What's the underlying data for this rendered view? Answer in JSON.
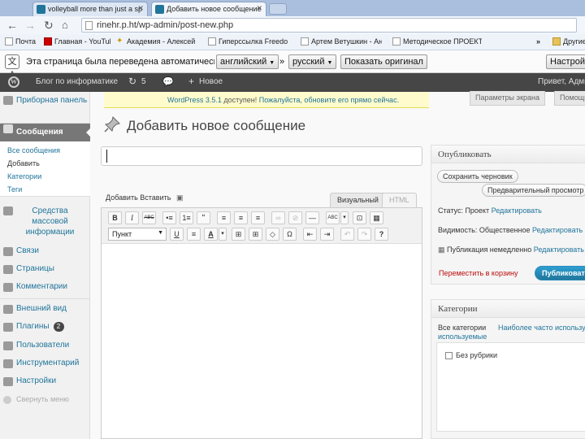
{
  "browser": {
    "tabs": [
      {
        "title": "volleyball more than just a sp"
      },
      {
        "title": "Добавить новое сообщение"
      }
    ],
    "url": "rinehr.p.ht/wp-admin/post-new.php",
    "bookmarks": [
      {
        "label": "Почта"
      },
      {
        "label": "Главная - YouTube"
      },
      {
        "label": "Академия - Алексей Ка"
      },
      {
        "label": "Гиперссылка Freedo"
      },
      {
        "label": "Артем Ветушкин - Ан"
      },
      {
        "label": "Методическое ПРОЕКТ"
      },
      {
        "label": "Другие"
      }
    ],
    "overflow": "»"
  },
  "translate_bar": {
    "message": "Эта страница была переведена автоматически",
    "from_language": "английский",
    "arrow": "»",
    "to_language": "русский",
    "show_original": "Показать оригинал",
    "settings": "Настройки"
  },
  "admin_bar": {
    "site_name": "Блог по информатике",
    "updates_count": "5",
    "new_label": "Новое",
    "greeting": "Привет, Адми"
  },
  "sidebar": {
    "dashboard": "Приборная панель",
    "posts": "Сообщения",
    "submenu": [
      "Все сообщения",
      "Добавить",
      "Категории",
      "Теги"
    ],
    "media": "Средства массовой информации",
    "links": "Связи",
    "pages": "Страницы",
    "comments": "Комментарии",
    "appearance": "Внешний вид",
    "plugins": "Плагины",
    "plugins_badge": "2",
    "users": "Пользователи",
    "tools": "Инструментарий",
    "settings": "Настройки",
    "collapse": "Свернуть меню"
  },
  "notice": {
    "version": "WordPress 3.5.1",
    "text": " доступен! ",
    "link": "Пожалуйста, обновите его прямо сейчас."
  },
  "screen_options": "Параметры экрана",
  "help": "Помощь",
  "page_title": "Добавить новое сообщение",
  "editor": {
    "add_media": "Добавить Вставить",
    "tab_visual": "Визуальный",
    "tab_html": "HTML",
    "format_select": "Пункт",
    "buttons_row1": [
      "B",
      "I",
      "ABC",
      "•≡",
      "1≡",
      "“",
      "≡",
      "≡",
      "≡",
      "∞",
      "⊘",
      "—",
      "ABC",
      "▾",
      "⊡",
      "▦"
    ],
    "buttons_row2": [
      "U",
      "≡",
      "A",
      "▾",
      "⊞",
      "⊞",
      "◇",
      "Ω",
      "⇤",
      "⇥",
      "↶",
      "↷",
      "?"
    ]
  },
  "publish_box": {
    "title": "Опубликовать",
    "save_draft": "Сохранить черновик",
    "preview": "Предварительный просмотр",
    "status_label": "Статус: Проект ",
    "status_edit": "Редактировать",
    "visibility_label": "Видимость: Общественное ",
    "visibility_edit": "Редактировать",
    "publish_label": "Публикация немедленно ",
    "publish_edit": "Редактировать",
    "trash": "Переместить в корзину",
    "publish": "Публиковать"
  },
  "categories_box": {
    "title": "Категории",
    "tab_all": "Все категории",
    "tab_popular": "Наиболее часто используемые",
    "items": [
      "Без рубрики"
    ]
  }
}
